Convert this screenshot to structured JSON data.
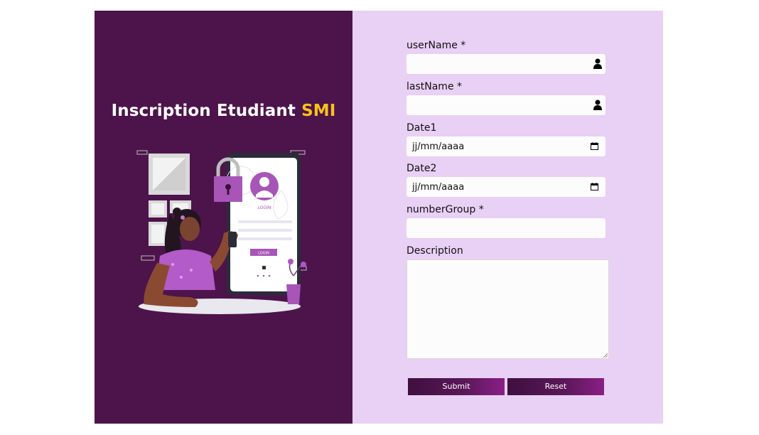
{
  "header": {
    "title_main": "Inscription Etudiant",
    "title_accent": "SMI"
  },
  "illustration": {
    "phone_text": "LOGIN",
    "button_text": "LOGIN"
  },
  "form": {
    "username": {
      "label": "userName *",
      "value": ""
    },
    "lastname": {
      "label": "lastName *",
      "value": ""
    },
    "date1": {
      "label": "Date1",
      "placeholder": "jj/mm/aaaa"
    },
    "date2": {
      "label": "Date2",
      "placeholder": "jj/mm/aaaa"
    },
    "number_group": {
      "label": "numberGroup *",
      "value": ""
    },
    "description": {
      "label": "Description",
      "value": ""
    }
  },
  "buttons": {
    "submit": "Submit",
    "reset": "Reset"
  },
  "colors": {
    "left_panel": "#4d144b",
    "right_panel": "#e9d0f5",
    "accent": "#f7c21a",
    "button": "#5b1859"
  },
  "icons": {
    "user_field": "user-icon",
    "date_field": "calendar-icon"
  }
}
